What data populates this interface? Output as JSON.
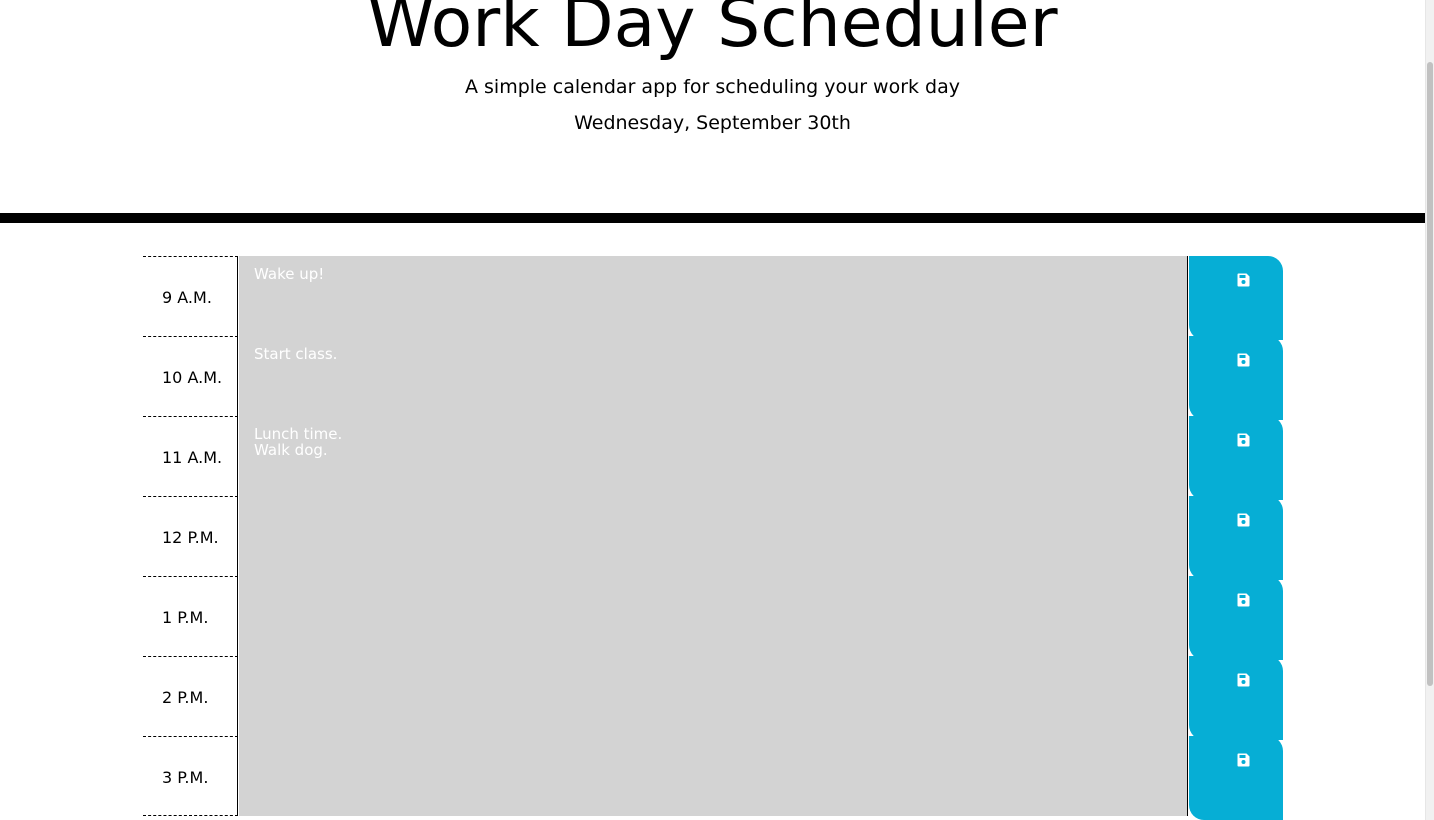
{
  "header": {
    "title": "Work Day Scheduler",
    "subtitle": "A simple calendar app for scheduling your work day",
    "current_day": "Wednesday, September 30th"
  },
  "time_blocks": [
    {
      "hour_label": "9 A.M.",
      "description": "Wake up!",
      "save_icon": "save-icon"
    },
    {
      "hour_label": "10 A.M.",
      "description": "Start class.",
      "save_icon": "save-icon"
    },
    {
      "hour_label": "11 A.M.",
      "description": "Lunch time.\nWalk dog.",
      "save_icon": "save-icon"
    },
    {
      "hour_label": "12 P.M.",
      "description": "",
      "save_icon": "save-icon"
    },
    {
      "hour_label": "1 P.M.",
      "description": "",
      "save_icon": "save-icon"
    },
    {
      "hour_label": "2 P.M.",
      "description": "",
      "save_icon": "save-icon"
    },
    {
      "hour_label": "3 P.M.",
      "description": "",
      "save_icon": "save-icon"
    }
  ],
  "colors": {
    "past_block": "#d3d3d3",
    "save_button": "#06aed5",
    "divider": "#000000"
  }
}
